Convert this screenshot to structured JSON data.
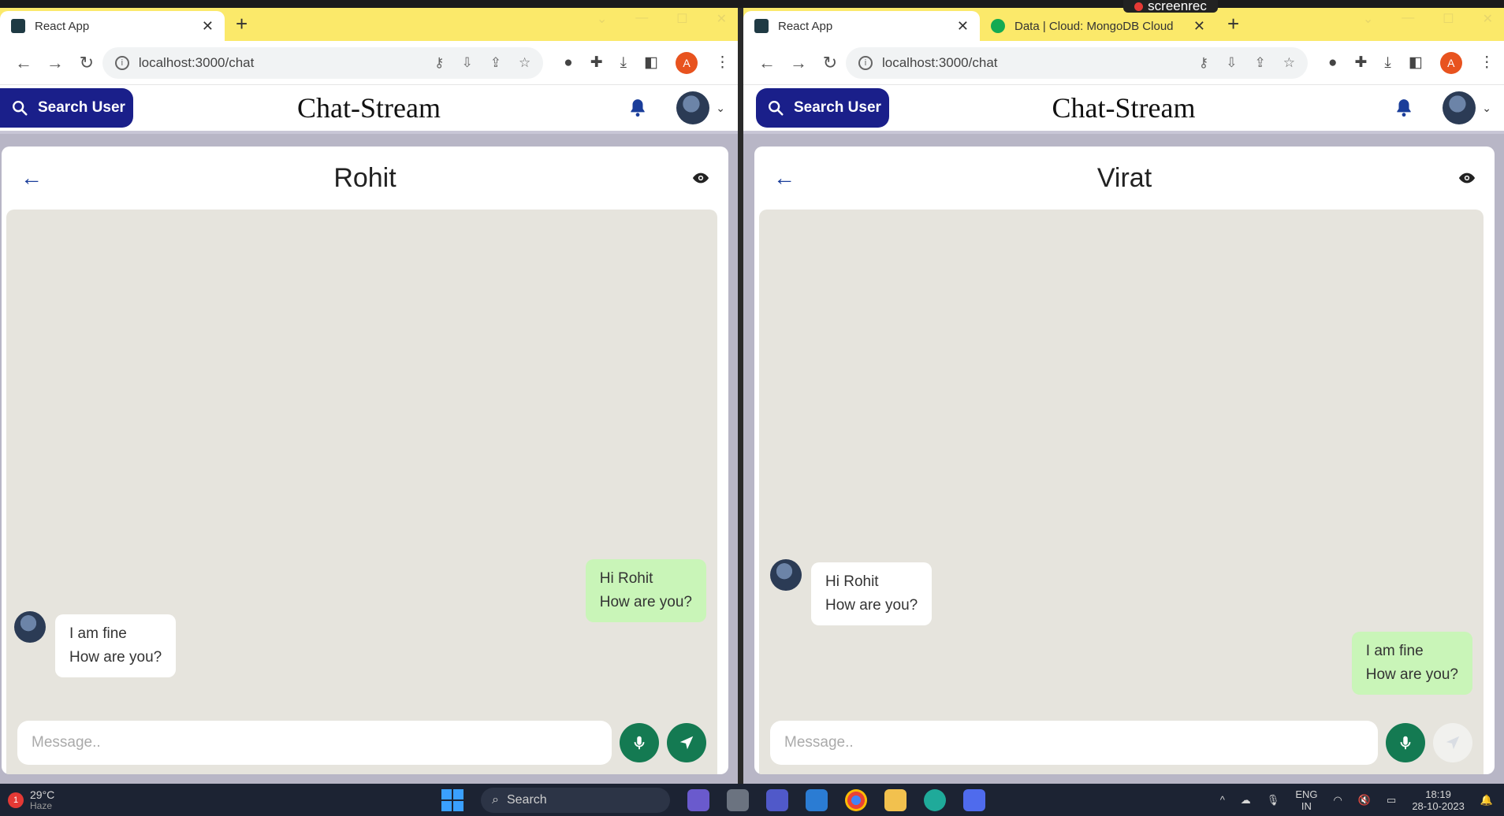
{
  "overlay": {
    "recorder_label": "screenrec"
  },
  "left": {
    "tabs": [
      {
        "title": "React App",
        "active": true,
        "icon": "react-icon"
      }
    ],
    "url": "localhost:3000/chat",
    "profile_initial": "A",
    "app": {
      "search_label": "Search User",
      "brand": "Chat-Stream",
      "chat_title": "Rohit",
      "messages": [
        {
          "from": "me",
          "line1": "Hi Rohit",
          "line2": "How are you?"
        },
        {
          "from": "them",
          "line1": "I am fine",
          "line2": "How are you?"
        }
      ],
      "input_placeholder": "Message.."
    }
  },
  "right": {
    "tabs": [
      {
        "title": "React App",
        "active": true,
        "icon": "react-icon"
      },
      {
        "title": "Data | Cloud: MongoDB Cloud",
        "active": false,
        "icon": "mongodb-icon"
      }
    ],
    "url": "localhost:3000/chat",
    "profile_initial": "A",
    "app": {
      "search_label": "Search User",
      "brand": "Chat-Stream",
      "chat_title": "Virat",
      "messages": [
        {
          "from": "them",
          "line1": "Hi Rohit",
          "line2": "How are you?"
        },
        {
          "from": "me",
          "line1": "I am fine",
          "line2": "How are you?"
        }
      ],
      "input_placeholder": "Message.."
    }
  },
  "taskbar": {
    "temperature": "29°C",
    "weather_desc": "Haze",
    "weather_alert": "1",
    "search_label": "Search",
    "language": "ENG",
    "language_region": "IN",
    "time": "18:19",
    "date": "28-10-2023"
  },
  "colors": {
    "brand_blue": "#1a1f8a",
    "mic_green": "#147a52",
    "outgoing_bubble": "#c9f5b8",
    "chat_bg": "#e6e4dd",
    "tab_strip": "#fbe96a"
  }
}
